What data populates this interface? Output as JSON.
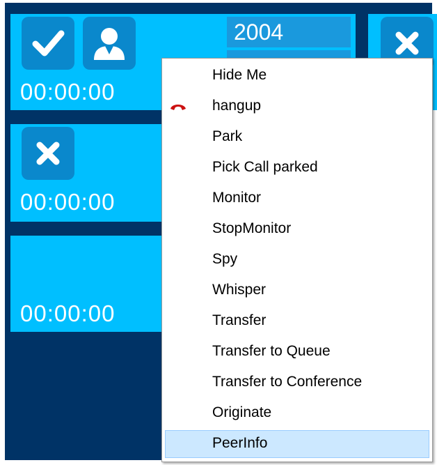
{
  "tiles": [
    {
      "timer": "00:00:00",
      "extension": "2004",
      "icons": [
        "check-icon",
        "user-icon"
      ]
    },
    {
      "timer": "00:00:00",
      "icons": [
        "close-icon"
      ]
    },
    {
      "timer": "00:00:00",
      "icons": []
    }
  ],
  "right_tile": {
    "icons": [
      "close-icon"
    ]
  },
  "context_menu": {
    "items": [
      {
        "label": "Hide Me"
      },
      {
        "label": "hangup",
        "icon": "hangup-icon"
      },
      {
        "label": "Park"
      },
      {
        "label": "Pick Call parked"
      },
      {
        "label": "Monitor"
      },
      {
        "label": "StopMonitor"
      },
      {
        "label": "Spy"
      },
      {
        "label": "Whisper"
      },
      {
        "label": "Transfer"
      },
      {
        "label": "Transfer to Queue"
      },
      {
        "label": "Transfer to Conference"
      },
      {
        "label": "Originate"
      },
      {
        "label": "PeerInfo",
        "selected": true
      }
    ]
  },
  "colors": {
    "background": "#003366",
    "tile": "#00bfff",
    "button": "#0a88cc",
    "menu_highlight": "#cce8ff",
    "hangup": "#cc1111"
  }
}
